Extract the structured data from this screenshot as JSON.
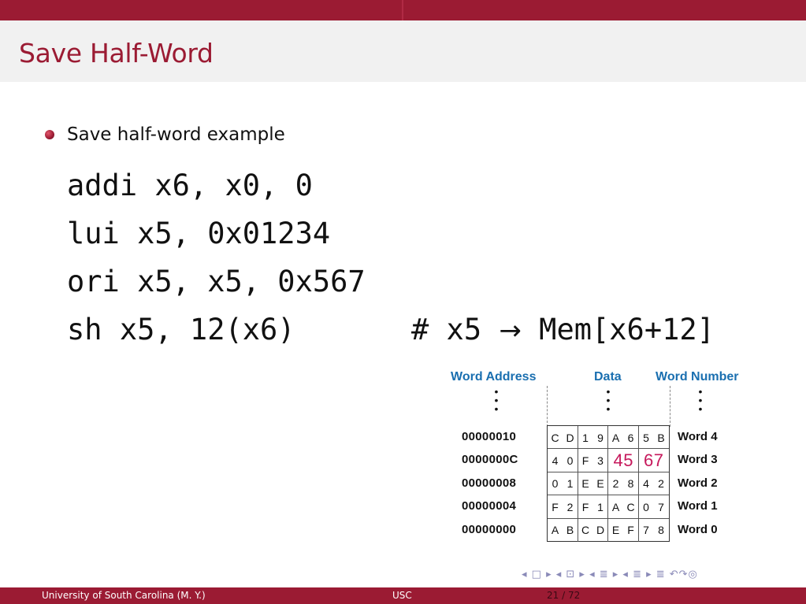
{
  "slide": {
    "title": "Save Half-Word",
    "bullet": "Save half-word example"
  },
  "code": {
    "lines": [
      "addi x6, x0, 0",
      "lui x5, 0x01234",
      "ori x5, x5, 0x567",
      "sh x5, 12(x6)"
    ],
    "comment_prefix": "# x5 ",
    "comment_arrow": "→",
    "comment_suffix": " Mem[x6+12]"
  },
  "memory": {
    "header_address": "Word Address",
    "header_data": "Data",
    "header_word": "Word Number",
    "dot": "•",
    "rows": [
      {
        "address": "00000010",
        "bytes": [
          [
            "C",
            "D"
          ],
          [
            "1",
            "9"
          ],
          [
            "A",
            "6"
          ],
          [
            "5",
            "B"
          ]
        ],
        "word": "Word 4"
      },
      {
        "address": "0000000C",
        "bytes": [
          [
            "4",
            "0"
          ],
          [
            "F",
            "3"
          ],
          [
            "45"
          ],
          [
            "67"
          ]
        ],
        "word": "Word 3"
      },
      {
        "address": "00000008",
        "bytes": [
          [
            "0",
            "1"
          ],
          [
            "E",
            "E"
          ],
          [
            "2",
            "8"
          ],
          [
            "4",
            "2"
          ]
        ],
        "word": "Word 2"
      },
      {
        "address": "00000004",
        "bytes": [
          [
            "F",
            "2"
          ],
          [
            "F",
            "1"
          ],
          [
            "A",
            "C"
          ],
          [
            "0",
            "7"
          ]
        ],
        "word": "Word 1"
      },
      {
        "address": "00000000",
        "bytes": [
          [
            "A",
            "B"
          ],
          [
            "C",
            "D"
          ],
          [
            "E",
            "F"
          ],
          [
            "7",
            "8"
          ]
        ],
        "word": "Word 0"
      }
    ],
    "highlight_color": "#c6195c"
  },
  "nav": {
    "symbols": "◂ □ ▸ ◂ ⊡ ▸ ◂ ≣ ▸ ◂ ≣ ▸   ≣   ↶↷◎"
  },
  "footer": {
    "left": "University of South Carolina  (M. Y.)",
    "middle": "USC",
    "page": "21 / 72"
  },
  "colors": {
    "theme": "#9b1b33",
    "header_blue": "#1a6fb0"
  }
}
